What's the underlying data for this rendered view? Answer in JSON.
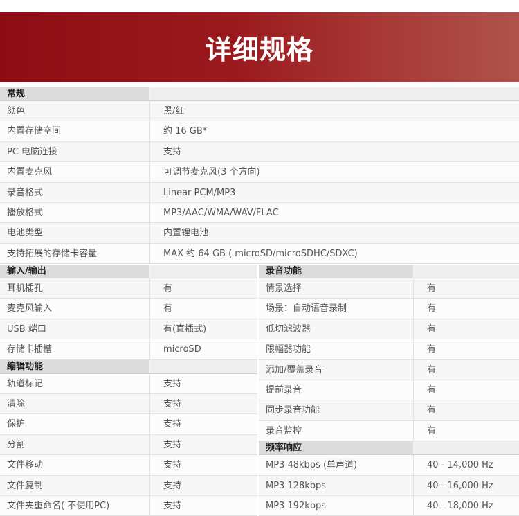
{
  "banner": {
    "title": "详细规格"
  },
  "general": {
    "title": "常规",
    "rows": [
      {
        "label": "颜色",
        "value": "黑/红"
      },
      {
        "label": "内置存储空间",
        "value": "约 16 GB*"
      },
      {
        "label": "PC 电脑连接",
        "value": "支持"
      },
      {
        "label": "内置麦克风",
        "value": "可调节麦克风(3 个方向)"
      },
      {
        "label": "录音格式",
        "value": "Linear PCM/MP3"
      },
      {
        "label": "播放格式",
        "value": "MP3/AAC/WMA/WAV/FLAC"
      },
      {
        "label": "电池类型",
        "value": "内置锂电池"
      },
      {
        "label": "支持拓展的存储卡容量",
        "value": "MAX 约 64 GB ( microSD/microSDHC/SDXC)"
      }
    ]
  },
  "io": {
    "title": "输入/输出",
    "rows": [
      {
        "label": "耳机插孔",
        "value": "有"
      },
      {
        "label": "麦克风输入",
        "value": "有"
      },
      {
        "label": "USB 端口",
        "value": "有(直插式)"
      },
      {
        "label": "存储卡插槽",
        "value": "microSD"
      }
    ]
  },
  "edit": {
    "title": "编辑功能",
    "rows": [
      {
        "label": "轨道标记",
        "value": "支持"
      },
      {
        "label": "清除",
        "value": "支持"
      },
      {
        "label": "保护",
        "value": "支持"
      },
      {
        "label": "分割",
        "value": "支持"
      },
      {
        "label": "文件移动",
        "value": "支持"
      },
      {
        "label": "文件复制",
        "value": "支持"
      },
      {
        "label": "文件夹重命名( 不使用PC)",
        "value": "支持"
      }
    ]
  },
  "recording": {
    "title": "录音功能",
    "rows": [
      {
        "label": "情景选择",
        "value": "有"
      },
      {
        "label": "场景：自动语音录制",
        "value": "有"
      },
      {
        "label": "低切滤波器",
        "value": "有"
      },
      {
        "label": "限幅器功能",
        "value": "有"
      },
      {
        "label": "添加/覆盖录音",
        "value": "有"
      },
      {
        "label": "提前录音",
        "value": "有"
      },
      {
        "label": "同步录音功能",
        "value": "有"
      },
      {
        "label": "录音监控",
        "value": "有"
      }
    ]
  },
  "frequency": {
    "title": "频率响应",
    "rows": [
      {
        "label": "MP3 48kbps (单声道)",
        "value": "40 - 14,000 Hz"
      },
      {
        "label": "MP3 128kbps",
        "value": "40 - 16,000 Hz"
      },
      {
        "label": "MP3 192kbps",
        "value": "40 - 18,000 Hz"
      }
    ]
  }
}
